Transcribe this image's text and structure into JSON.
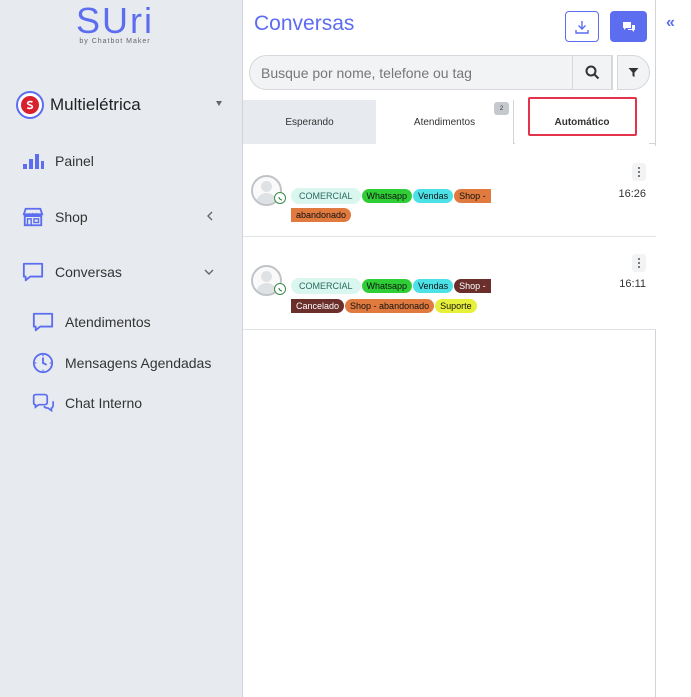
{
  "sidebar": {
    "logo": {
      "main": "SUri",
      "sub": "by Chatbot Maker"
    },
    "company": {
      "name": "Multielétrica"
    },
    "nav": {
      "painel": "Painel",
      "shop": "Shop",
      "conversas": "Conversas"
    },
    "subnav": {
      "atendimentos": "Atendimentos",
      "mensagens": "Mensagens Agendadas",
      "chat": "Chat Interno"
    },
    "icons": {
      "painel": "bar-chart-icon",
      "shop": "store-icon",
      "conversas": "chat-bubble-icon",
      "atendimentos": "chat-bubble-icon",
      "mensagens": "clock-icon",
      "chat": "chat-people-icon"
    }
  },
  "main": {
    "title": "Conversas",
    "search": {
      "placeholder": "Busque por nome, telefone ou tag"
    },
    "tabs": [
      {
        "label": "Esperando"
      },
      {
        "label": "Atendimentos",
        "badge": "2"
      },
      {
        "label": "Automático"
      }
    ],
    "conversations": [
      {
        "time": "16:26",
        "tags": [
          "COMERCIAL",
          "Whatsapp",
          "Vendas",
          "Shop -",
          "abandonado"
        ]
      },
      {
        "time": "16:11",
        "tags": [
          "COMERCIAL",
          "Whatsapp",
          "Vendas",
          "Shop -",
          "Cancelado",
          "Shop - abandonado",
          "Suporte"
        ]
      }
    ]
  },
  "rightbar": {
    "collapse": "«"
  },
  "colors": {
    "accent": "#5c6df0",
    "sidebar_bg": "#e7ebef",
    "highlight": "#e2334a",
    "tag_whatsapp": "#2fce36",
    "tag_vendas": "#4ce0e7",
    "tag_shop": "#e07a3e",
    "tag_cancelado": "#6a2e2b",
    "tag_suporte": "#e6f03a",
    "tag_comercial": "#d9f7ee"
  }
}
